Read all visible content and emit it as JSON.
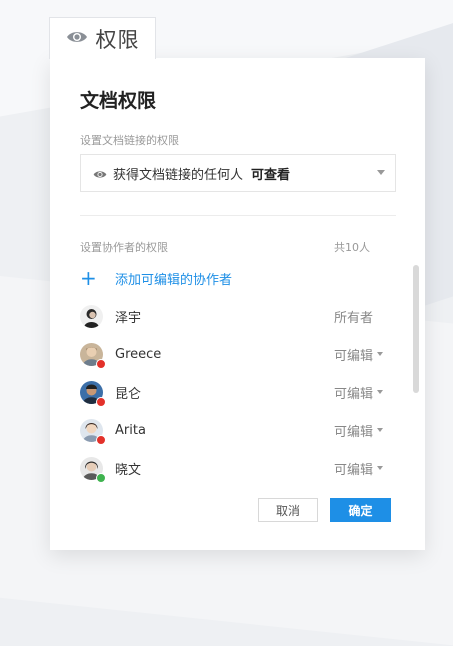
{
  "tab": {
    "label": "权限",
    "icon": "eye-icon"
  },
  "dialog": {
    "title": "文档权限",
    "link_section_label": "设置文档链接的权限",
    "link_select": {
      "text": "获得文档链接的任何人",
      "permission": "可查看"
    },
    "collab_section_label": "设置协作者的权限",
    "collab_count": "共10人",
    "add_collaborator": "添加可编辑的协作者",
    "members": [
      {
        "name": "泽宇",
        "role": "所有者",
        "has_dropdown": false
      },
      {
        "name": "Greece",
        "role": "可编辑",
        "has_dropdown": true
      },
      {
        "name": "昆仑",
        "role": "可编辑",
        "has_dropdown": true
      },
      {
        "name": "Arita",
        "role": "可编辑",
        "has_dropdown": true
      },
      {
        "name": "晓文",
        "role": "可编辑",
        "has_dropdown": true
      }
    ],
    "cancel_label": "取消",
    "ok_label": "确定"
  },
  "colors": {
    "accent": "#1e8fe6",
    "badge": "#e3312a"
  }
}
